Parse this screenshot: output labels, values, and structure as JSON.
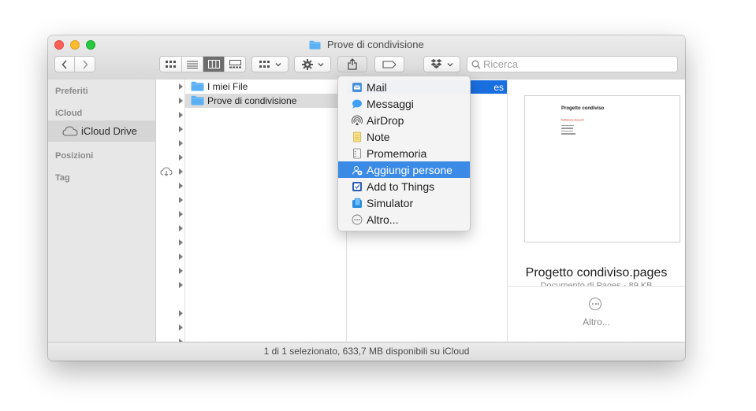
{
  "window": {
    "title": "Prove di condivisione"
  },
  "toolbar": {
    "back_icon": "chevron-left-icon",
    "forward_icon": "chevron-right-icon",
    "view_modes": [
      "icon-view",
      "list-view",
      "column-view",
      "gallery-view"
    ],
    "active_view": "column-view",
    "group_icon": "group-by-icon",
    "action_icon": "gear-icon",
    "share_icon": "share-icon",
    "tag_icon": "tag-icon",
    "dropbox_icon": "dropbox-icon",
    "search_placeholder": "Ricerca"
  },
  "sidebar": {
    "sections": [
      {
        "heading": "Preferiti"
      },
      {
        "heading": "iCloud"
      },
      {
        "heading": "Posizioni"
      },
      {
        "heading": "Tag"
      }
    ],
    "items": [
      {
        "label": "iCloud Drive",
        "icon": "cloud-icon",
        "section": "iCloud",
        "selected": true
      }
    ]
  },
  "columns": {
    "col2_rows": [
      {
        "label": "I miei File",
        "icon": "folder-icon",
        "selected": false
      },
      {
        "label": "Prove di condivisione",
        "icon": "folder-icon",
        "selected": true
      }
    ],
    "col3_selected_suffix": "es"
  },
  "share_menu": {
    "items": [
      {
        "label": "Mail",
        "icon": "mail-icon",
        "highlighted": false
      },
      {
        "label": "Messaggi",
        "icon": "messages-icon",
        "highlighted": false
      },
      {
        "label": "AirDrop",
        "icon": "airdrop-icon",
        "highlighted": false
      },
      {
        "label": "Note",
        "icon": "notes-icon",
        "highlighted": false
      },
      {
        "label": "Promemoria",
        "icon": "reminders-icon",
        "highlighted": false
      },
      {
        "label": "Aggiungi persone",
        "icon": "add-people-icon",
        "highlighted": true
      },
      {
        "label": "Add to Things",
        "icon": "things-icon",
        "highlighted": false
      },
      {
        "label": "Simulator",
        "icon": "simulator-icon",
        "highlighted": false
      },
      {
        "label": "Altro...",
        "icon": "more-icon",
        "highlighted": false
      }
    ]
  },
  "preview": {
    "doc_title": "Progetto condiviso",
    "doc_subtitle": "Definizione dei punti",
    "doc_list": [
      "1. Punto uno",
      "2. Punto due",
      "3. Punto tre",
      "4. Punto quattro"
    ],
    "file_name": "Progetto condiviso.pages",
    "file_info": "Documento di Pages - 89 KB",
    "more_label": "Altro..."
  },
  "status": {
    "text": "1 di 1 selezionato, 633,7 MB disponibili su iCloud"
  },
  "colors": {
    "selection_blue": "#1a6fe0",
    "menu_highlight": "#3a8ae6",
    "folder_blue": "#5ab0f2"
  }
}
